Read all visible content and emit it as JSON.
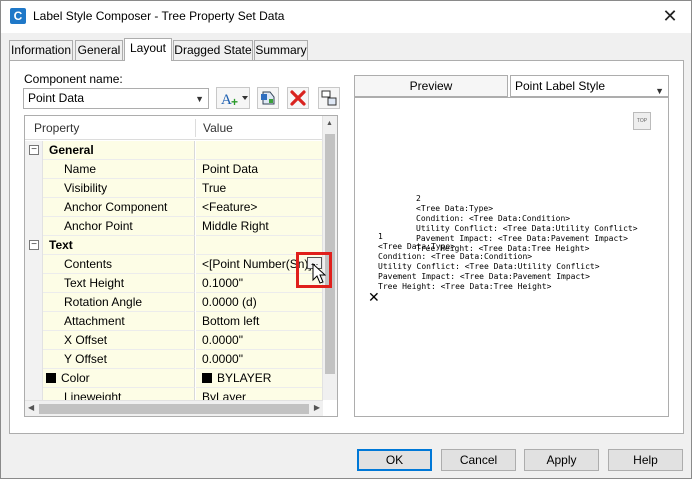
{
  "window": {
    "title": "Label Style Composer - Tree Property Set Data",
    "app_icon": "C",
    "close_glyph": "✕"
  },
  "tabs": [
    "Information",
    "General",
    "Layout",
    "Dragged State",
    "Summary"
  ],
  "component": {
    "label": "Component name:",
    "value": "Point Data"
  },
  "toolbar": {
    "add_glyph": "A+",
    "delete_glyph": "✕"
  },
  "grid": {
    "headers": {
      "property": "Property",
      "value": "Value"
    },
    "general": {
      "label": "General",
      "rows": [
        {
          "property": "Name",
          "value": "Point Data"
        },
        {
          "property": "Visibility",
          "value": "True"
        },
        {
          "property": "Anchor Component",
          "value": "<Feature>"
        },
        {
          "property": "Anchor Point",
          "value": "Middle Right"
        }
      ]
    },
    "text": {
      "label": "Text",
      "rows": [
        {
          "property": "Contents",
          "value": "<[Point Number(Sn)]>"
        },
        {
          "property": "Text Height",
          "value": "0.1000\""
        },
        {
          "property": "Rotation Angle",
          "value": "0.0000 (d)"
        },
        {
          "property": "Attachment",
          "value": "Bottom left"
        },
        {
          "property": "X Offset",
          "value": "0.0000\""
        },
        {
          "property": "Y Offset",
          "value": "0.0000\""
        },
        {
          "property": "Color",
          "value": "BYLAYER"
        },
        {
          "property": "Lineweight",
          "value": "ByLayer"
        }
      ]
    },
    "expander_glyph": "−",
    "ellipsis": "..."
  },
  "preview": {
    "tab_label": "Preview",
    "style_select": "Point Label Style",
    "top_button": "TOP",
    "block_a": "2\n<Tree Data:Type>\nCondition: <Tree Data:Condition>\nUtility Conflict: <Tree Data:Utility Conflict>\nPavement Impact: <Tree Data:Pavement Impact>\nTree Height: <Tree Data:Tree Height>",
    "block_b": "1\n<Tree Data:Type>\nCondition: <Tree Data:Condition>\nUtility Conflict: <Tree Data:Utility Conflict>\nPavement Impact: <Tree Data:Pavement Impact>\nTree Height: <Tree Data:Tree Height>",
    "marker": "✕"
  },
  "buttons": {
    "ok": "OK",
    "cancel": "Cancel",
    "apply": "Apply",
    "help": "Help"
  }
}
